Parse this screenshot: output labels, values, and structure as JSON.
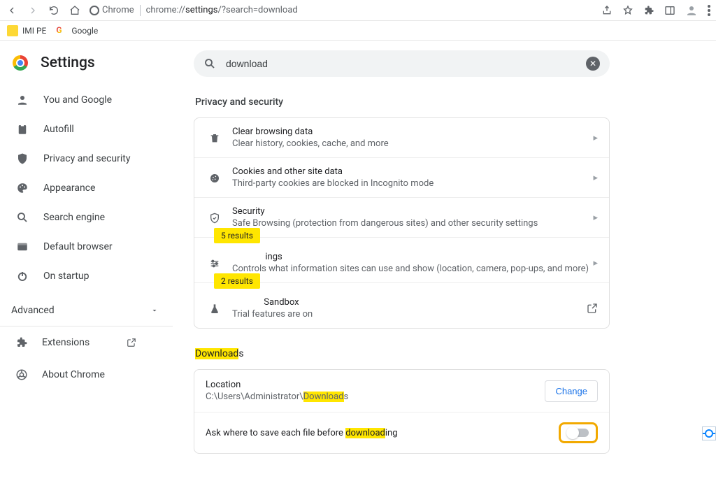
{
  "toolbar": {
    "omni_prefix": "Chrome",
    "omni_path_prefix": "chrome://",
    "omni_path_bold": "settings",
    "omni_path_rest": "/?search=download"
  },
  "bookmarks": [
    {
      "label": "IMI PE"
    },
    {
      "label": "Google"
    }
  ],
  "app": {
    "title": "Settings"
  },
  "sidebar": {
    "items": [
      {
        "label": "You and Google"
      },
      {
        "label": "Autofill"
      },
      {
        "label": "Privacy and security"
      },
      {
        "label": "Appearance"
      },
      {
        "label": "Search engine"
      },
      {
        "label": "Default browser"
      },
      {
        "label": "On startup"
      }
    ],
    "advanced_label": "Advanced",
    "extensions_label": "Extensions",
    "about_label": "About Chrome"
  },
  "search": {
    "value": "download"
  },
  "privacy": {
    "section_title": "Privacy and security",
    "rows": [
      {
        "title": "Clear browsing data",
        "sub": "Clear history, cookies, cache, and more"
      },
      {
        "title": "Cookies and other site data",
        "sub": "Third-party cookies are blocked in Incognito mode"
      },
      {
        "title": "Security",
        "sub": "Safe Browsing (protection from dangerous sites) and other security settings"
      },
      {
        "title_suffix": "ings",
        "sub": "Controls what information sites can use and show (location, camera, pop-ups, and more)",
        "bubble": "5 results"
      },
      {
        "title_suffix": "Sandbox",
        "sub": "Trial features are on",
        "bubble": "2 results"
      }
    ]
  },
  "downloads": {
    "heading_hl": "Download",
    "heading_rest": "s",
    "location_label": "Location",
    "location_prefix": "C:\\Users\\Administrator\\",
    "location_hl": "Download",
    "location_suffix": "s",
    "change_label": "Change",
    "ask_prefix": "Ask where to save each file before ",
    "ask_hl": "download",
    "ask_suffix": "ing"
  }
}
